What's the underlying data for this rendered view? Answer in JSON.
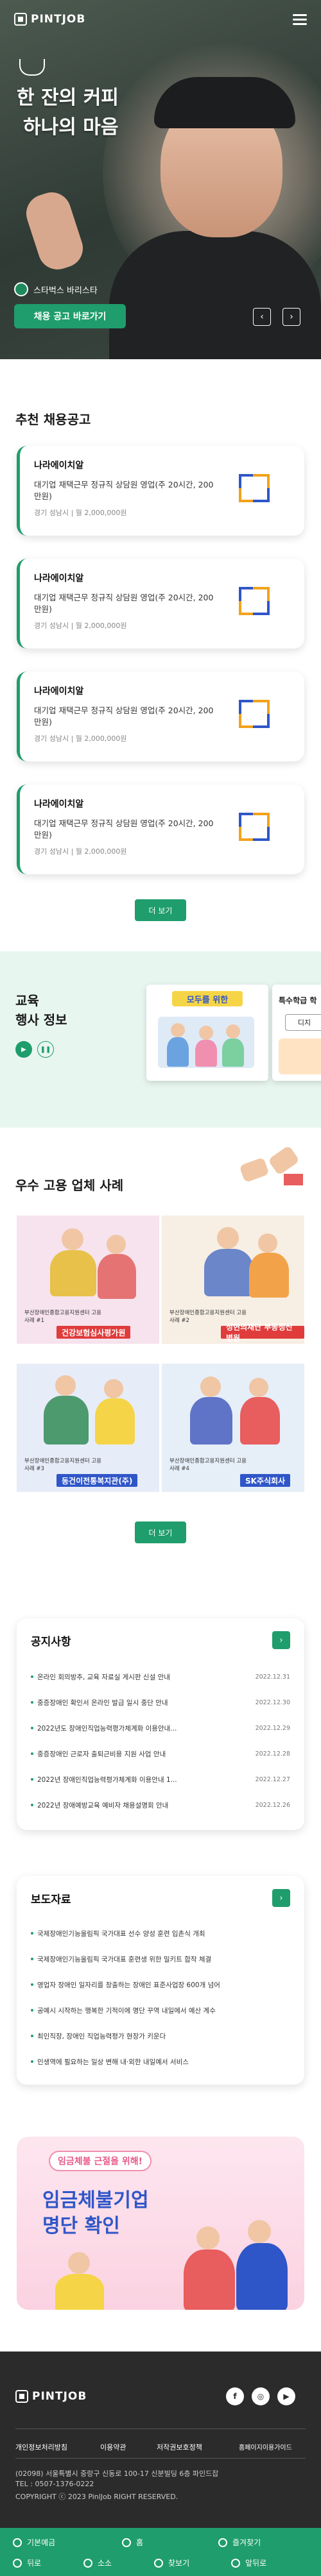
{
  "header": {
    "logo_text": "PINTJOB",
    "hero_line1": "한 잔의 커피",
    "hero_line2": "하나의 마음",
    "hero_badge": "스타벅스 바리스타",
    "hero_cta": "채용 공고 바로가기"
  },
  "jobs": {
    "title": "추천 채용공고",
    "items": [
      {
        "company": "나라에이치알",
        "title": "대기업 재택근무 정규직 상담원 영업(주 20시간, 200만원)",
        "meta": "경기 성남시 | 월 2,000,000원"
      },
      {
        "company": "나라에이치알",
        "title": "대기업 재택근무 정규직 상담원 영업(주 20시간, 200만원)",
        "meta": "경기 성남시 | 월 2,000,000원"
      },
      {
        "company": "나라에이치알",
        "title": "대기업 재택근무 정규직 상담원 영업(주 20시간, 200만원)",
        "meta": "경기 성남시 | 월 2,000,000원"
      },
      {
        "company": "나라에이치알",
        "title": "대기업 재택근무 정규직 상담원 영업(주 20시간, 200만원)",
        "meta": "경기 성남시 | 월 2,000,000원"
      }
    ],
    "more_label": "더 보기"
  },
  "edu": {
    "title_line1": "교육",
    "title_line2": "행사 정보",
    "poster1_title": "모두를 위한",
    "poster2_title": "특수학급 학",
    "poster2_sub": "디지"
  },
  "employers": {
    "title": "우수 고용 업체 사례",
    "tiles": [
      {
        "caption": "부산장애인종합고용지원센터 고용사례 #1",
        "label": "건강보험심사평가원",
        "bg": "#f6e3ee",
        "label_bg": "#e03c3c"
      },
      {
        "caption": "부산장애인종합고용지원센터 고용사례 #2",
        "label": "성현의재단 부동정신병원",
        "bg": "#f7eee4",
        "label_bg": "#e03c3c"
      },
      {
        "caption": "부산장애인종합고용지원센터 고용사례 #3",
        "label": "동건이전통복지관(주)",
        "bg": "#e6ecf8",
        "label_bg": "#2f56c8"
      },
      {
        "caption": "부산장애인종합고용지원센터 고용사례 #4",
        "label": "SK주식회사",
        "bg": "#e6eef8",
        "label_bg": "#2f56c8"
      }
    ],
    "more_label": "더 보기"
  },
  "notices": {
    "title": "공지사항",
    "items": [
      {
        "title": "온라인 회의방추, 교육 자료실 게시판 신설 안내",
        "date": "2022.12.31"
      },
      {
        "title": "중증장애인 확인서 온라인 발급 일시 중단 안내",
        "date": "2022.12.30"
      },
      {
        "title": "2022년도 장애인직업능력평가체계화 이용안내...",
        "date": "2022.12.29"
      },
      {
        "title": "중증장애인 근로자 출퇴근비용 지원 사업 안내",
        "date": "2022.12.28"
      },
      {
        "title": "2022년 장애인직업능력평가체계화 이용안내 1...",
        "date": "2022.12.27"
      },
      {
        "title": "2022년 장애예방교육 예비자 채용설명회 안내",
        "date": "2022.12.26"
      }
    ]
  },
  "press": {
    "title": "보도자료",
    "items": [
      "국제장애인기능올림픽 국가대표 선수 양성 훈련 입촌식 개최",
      "국제장애인기능올림픽 국가대표 훈련생 위한 밀키트 합작 체결",
      "영업자 장애인 일자리를 창출하는 장애인 표준사업장 600개 넘어",
      "공예시 시작하는 행복한 기적이에 명단 꾸역 내일에서 예산 계수",
      "최인직장, 장애인 직업능력평가 현장가 키운다",
      "인생역에 필요하는 일상 변해 내·외한 내일예서 서비스"
    ]
  },
  "banner": {
    "tag": "임금체불 근절을 위해!",
    "headline1": "임금체불기업",
    "headline2": "명단 확인"
  },
  "footer": {
    "logo_text": "PINTJOB",
    "links": [
      "개인정보처리방침",
      "이용약관",
      "저작권보호정책",
      "홈페이지이용가이드"
    ],
    "address": "(02098) 서울특별시 중랑구 신동로 100-17 신분빌딩 6층 파인드잡",
    "tel": "TEL : 0507-1376-0222",
    "copyright": "COPYRIGHT ⓒ 2023 PinlJob RIGHT RESERVED.",
    "sns": [
      "f",
      "◎",
      "▶"
    ]
  },
  "bottom_nav": {
    "items": [
      "기본예금",
      "홈",
      "즐겨찾기",
      "뒤로",
      "소소",
      "찾보기",
      "앞뒤로"
    ]
  }
}
